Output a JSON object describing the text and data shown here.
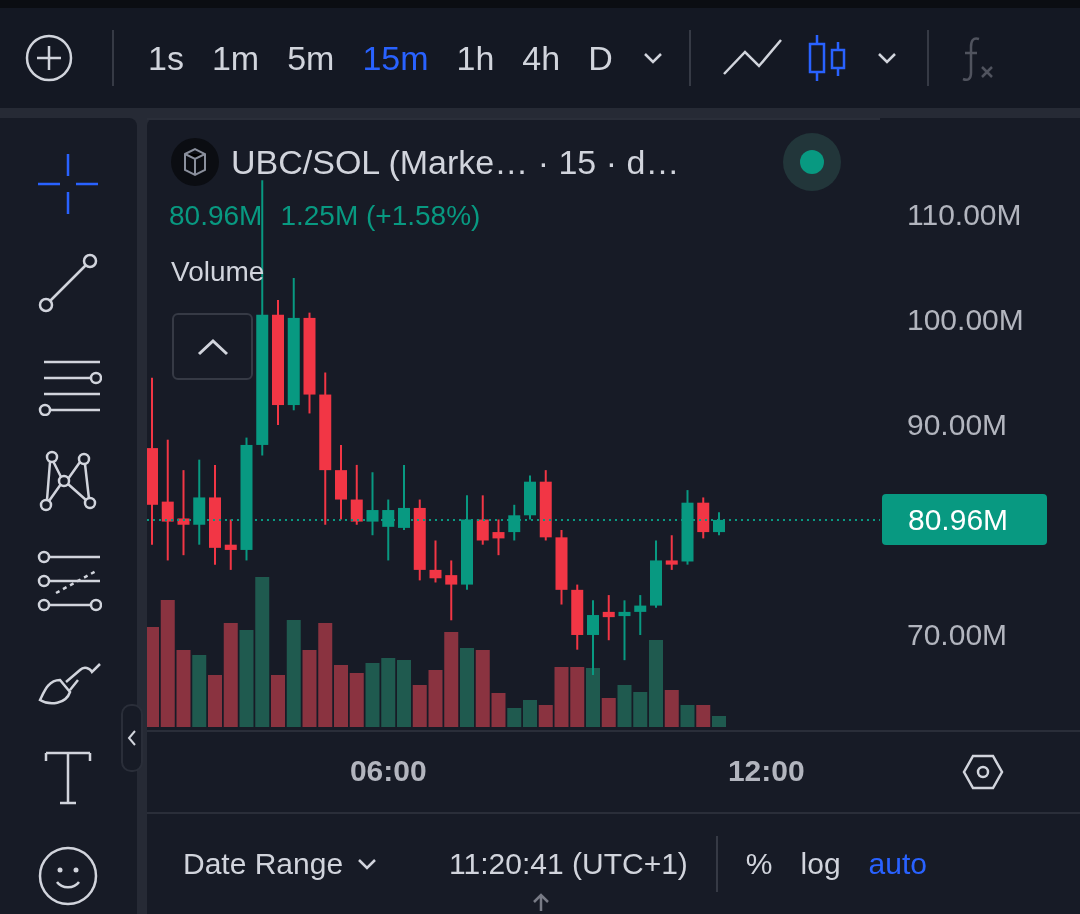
{
  "toolbar": {
    "intervals": [
      {
        "label": "1s",
        "selected": false
      },
      {
        "label": "1m",
        "selected": false
      },
      {
        "label": "5m",
        "selected": false
      },
      {
        "label": "15m",
        "selected": true
      },
      {
        "label": "1h",
        "selected": false
      },
      {
        "label": "4h",
        "selected": false
      },
      {
        "label": "D",
        "selected": false
      }
    ],
    "chart_styles": [
      {
        "kind": "line",
        "selected": false
      },
      {
        "kind": "candles",
        "selected": true
      }
    ]
  },
  "drawing_tools": [
    {
      "kind": "crosshair",
      "selected": true
    },
    {
      "kind": "trend_line",
      "selected": false
    },
    {
      "kind": "fib",
      "selected": false
    },
    {
      "kind": "pattern",
      "selected": false
    },
    {
      "kind": "prediction",
      "selected": false
    },
    {
      "kind": "brush",
      "selected": false
    },
    {
      "kind": "text",
      "selected": false
    },
    {
      "kind": "emoji",
      "selected": false
    }
  ],
  "chart": {
    "title": "UBC/SOL (Marke… · 15 · d…",
    "last_value": "80.96M",
    "change": "1.25M (+1.58%)",
    "indicator": "Volume",
    "last_price_tag": "80.96M",
    "chart_data": {
      "type": "candlestick",
      "categories": [
        null,
        null,
        null,
        null,
        null,
        null,
        null,
        null,
        null,
        null,
        null,
        null,
        null,
        null,
        null,
        "06:00",
        null,
        null,
        null,
        null,
        null,
        null,
        null,
        null,
        null,
        null,
        null,
        null,
        null,
        null,
        null,
        null,
        null,
        null,
        null,
        null,
        null,
        null,
        null,
        "12:00"
      ],
      "ohlc": [
        [
          87.8,
          94.5,
          78.6,
          82.4
        ],
        [
          82.7,
          88.6,
          77.1,
          80.8
        ],
        [
          81.1,
          85.7,
          77.6,
          80.5
        ],
        [
          80.5,
          86.7,
          78.6,
          83.1
        ],
        [
          83.1,
          86.2,
          76.7,
          78.3
        ],
        [
          78.6,
          81.0,
          76.2,
          78.1
        ],
        [
          78.1,
          88.8,
          77.1,
          88.1
        ],
        [
          88.1,
          113.3,
          87.1,
          100.5
        ],
        [
          100.5,
          101.9,
          90.0,
          91.9
        ],
        [
          91.9,
          104.0,
          91.4,
          100.2
        ],
        [
          100.2,
          100.7,
          91.1,
          92.9
        ],
        [
          92.9,
          95.0,
          80.5,
          85.7
        ],
        [
          85.7,
          88.1,
          81.0,
          82.9
        ],
        [
          82.9,
          86.2,
          80.5,
          80.8
        ],
        [
          80.8,
          85.5,
          79.5,
          81.9
        ],
        [
          80.3,
          82.9,
          77.1,
          81.9
        ],
        [
          80.2,
          86.2,
          80.0,
          82.1
        ],
        [
          82.1,
          82.9,
          75.2,
          76.2
        ],
        [
          76.2,
          79.0,
          75.0,
          75.4
        ],
        [
          75.7,
          77.1,
          71.4,
          74.8
        ],
        [
          74.8,
          83.3,
          74.3,
          81.0
        ],
        [
          81.0,
          83.3,
          78.6,
          79.0
        ],
        [
          79.8,
          81.0,
          77.6,
          79.2
        ],
        [
          79.8,
          82.4,
          79.0,
          81.4
        ],
        [
          81.4,
          85.2,
          81.0,
          84.6
        ],
        [
          84.6,
          85.7,
          79.0,
          79.3
        ],
        [
          79.3,
          80.0,
          72.9,
          74.3
        ],
        [
          74.3,
          74.8,
          68.6,
          70.0
        ],
        [
          70.0,
          73.3,
          66.2,
          71.9
        ],
        [
          72.2,
          73.8,
          69.5,
          71.7
        ],
        [
          71.8,
          73.3,
          67.6,
          72.2
        ],
        [
          72.2,
          73.8,
          70.0,
          72.8
        ],
        [
          72.8,
          79.0,
          72.6,
          77.1
        ],
        [
          77.1,
          79.5,
          76.2,
          76.7
        ],
        [
          77.0,
          83.8,
          76.7,
          82.6
        ],
        [
          82.6,
          83.1,
          79.2,
          79.8
        ],
        [
          79.8,
          81.7,
          79.5,
          80.96
        ],
        null,
        null,
        null
      ],
      "ylim": [
        60.95,
        119.24
      ],
      "ref_lines": [
        {
          "axis": "y",
          "value": 80.96,
          "color": "#089981"
        }
      ],
      "yticks": [
        {
          "value": 110,
          "label": "110.00M"
        },
        {
          "value": 100,
          "label": "100.00M"
        },
        {
          "value": 90,
          "label": "90.00M"
        },
        {
          "value": 70,
          "label": "70.00M"
        }
      ]
    }
  },
  "bottom_bar": {
    "date_range": "Date Range",
    "clock": "11:20:41 (UTC+1)",
    "scale_options": [
      {
        "label": "%",
        "selected": false
      },
      {
        "label": "log",
        "selected": false
      },
      {
        "label": "auto",
        "selected": true
      }
    ]
  }
}
